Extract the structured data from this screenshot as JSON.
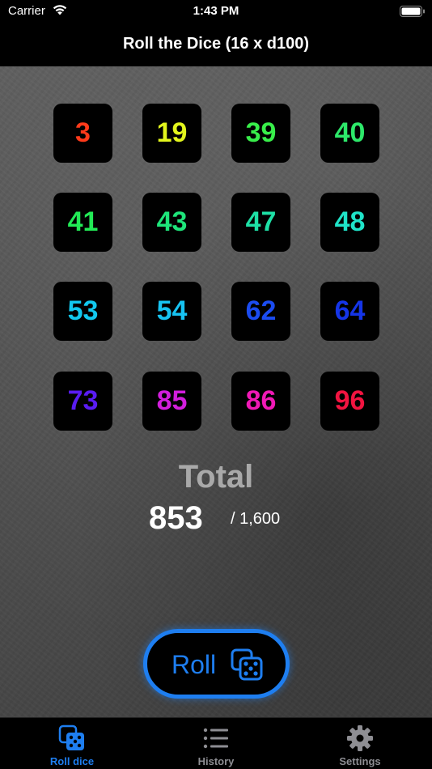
{
  "status": {
    "carrier": "Carrier",
    "time": "1:43 PM"
  },
  "nav": {
    "title": "Roll the Dice (16 x d100)"
  },
  "dice": [
    {
      "value": "3",
      "color": "#ff3a1a"
    },
    {
      "value": "19",
      "color": "#e2f51c"
    },
    {
      "value": "39",
      "color": "#38ee4a"
    },
    {
      "value": "40",
      "color": "#2de86a"
    },
    {
      "value": "41",
      "color": "#22ea56"
    },
    {
      "value": "43",
      "color": "#1ee47a"
    },
    {
      "value": "47",
      "color": "#1ee0a6"
    },
    {
      "value": "48",
      "color": "#1fe3c8"
    },
    {
      "value": "53",
      "color": "#12c8ee"
    },
    {
      "value": "54",
      "color": "#17c3f2"
    },
    {
      "value": "62",
      "color": "#1b4cf0"
    },
    {
      "value": "64",
      "color": "#1535e8"
    },
    {
      "value": "73",
      "color": "#5a1cf2"
    },
    {
      "value": "85",
      "color": "#d21edc"
    },
    {
      "value": "86",
      "color": "#f019b6"
    },
    {
      "value": "96",
      "color": "#f11440"
    }
  ],
  "total": {
    "label": "Total",
    "value": "853",
    "max": "/ 1,600"
  },
  "roll_button": {
    "label": "Roll",
    "icon": "dice-icon",
    "color": "#1e7ef0"
  },
  "tabs": [
    {
      "label": "Roll dice",
      "icon": "dice-icon",
      "active": true,
      "color": "#1e7ef0"
    },
    {
      "label": "History",
      "icon": "list-icon",
      "active": false,
      "color": "#8e8e93"
    },
    {
      "label": "Settings",
      "icon": "gear-icon",
      "active": false,
      "color": "#8e8e93"
    }
  ]
}
